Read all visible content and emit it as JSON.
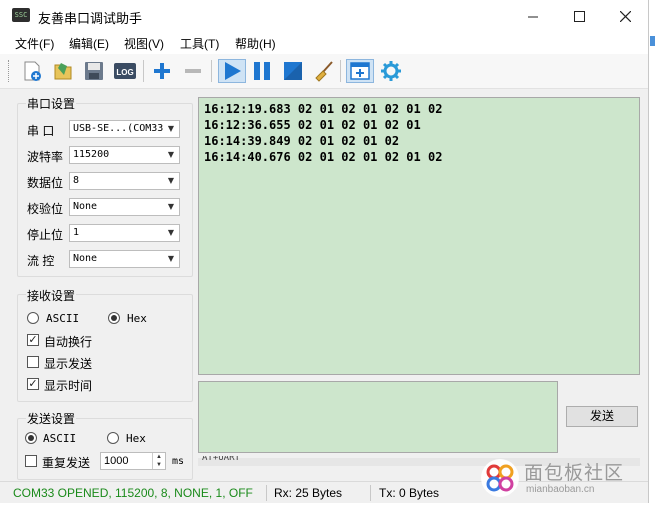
{
  "window": {
    "title": "友善串口调试助手",
    "app_icon_text": "SSC"
  },
  "menu": [
    "文件(F)",
    "编辑(E)",
    "视图(V)",
    "工具(T)",
    "帮助(H)"
  ],
  "toolbar_icons": [
    "new-file-icon",
    "open-icon",
    "save-icon",
    "log-icon",
    "add-icon",
    "remove-icon",
    "play-icon",
    "pause-icon",
    "stop-icon",
    "clear-broom-icon",
    "add-window-icon",
    "settings-gear-icon"
  ],
  "serial_settings": {
    "title": "串口设置",
    "fields": [
      {
        "label": "串  口",
        "value": "USB-SE...(COM33"
      },
      {
        "label": "波特率",
        "value": "115200"
      },
      {
        "label": "数据位",
        "value": "8"
      },
      {
        "label": "校验位",
        "value": "None"
      },
      {
        "label": "停止位",
        "value": "1"
      },
      {
        "label": "流  控",
        "value": "None"
      }
    ]
  },
  "receive_settings": {
    "title": "接收设置",
    "ascii_label": "ASCII",
    "hex_label": "Hex",
    "mode_selected": "Hex",
    "auto_newline_label": "自动换行",
    "auto_newline": true,
    "show_send_label": "显示发送",
    "show_send": false,
    "show_time_label": "显示时间",
    "show_time": true
  },
  "send_settings": {
    "title": "发送设置",
    "ascii_label": "ASCII",
    "hex_label": "Hex",
    "mode_selected": "ASCII",
    "repeat_label": "重复发送",
    "repeat": false,
    "interval_value": "1000",
    "interval_unit": "ms"
  },
  "receive_lines": [
    "16:12:19.683 02 01 02 01 02 01 02",
    "16:12:36.655 02 01 02 01 02 01",
    "16:14:39.849 02 01 02 01 02",
    "16:14:40.676 02 01 02 01 02 01 02"
  ],
  "partial_line": "AT+UART",
  "send_button_label": "发送",
  "status": {
    "port": "COM33 OPENED, 115200, 8, NONE, 1, OFF",
    "rx": "Rx: 25 Bytes",
    "tx": "Tx: 0 Bytes"
  },
  "watermark": {
    "cn": "面包板社区",
    "en": "mianbaoban.cn"
  },
  "colors": {
    "text_area_bg": "#cde6cc",
    "status_green": "#1a8a1a",
    "toolbar_blue": "#1f77d0"
  }
}
